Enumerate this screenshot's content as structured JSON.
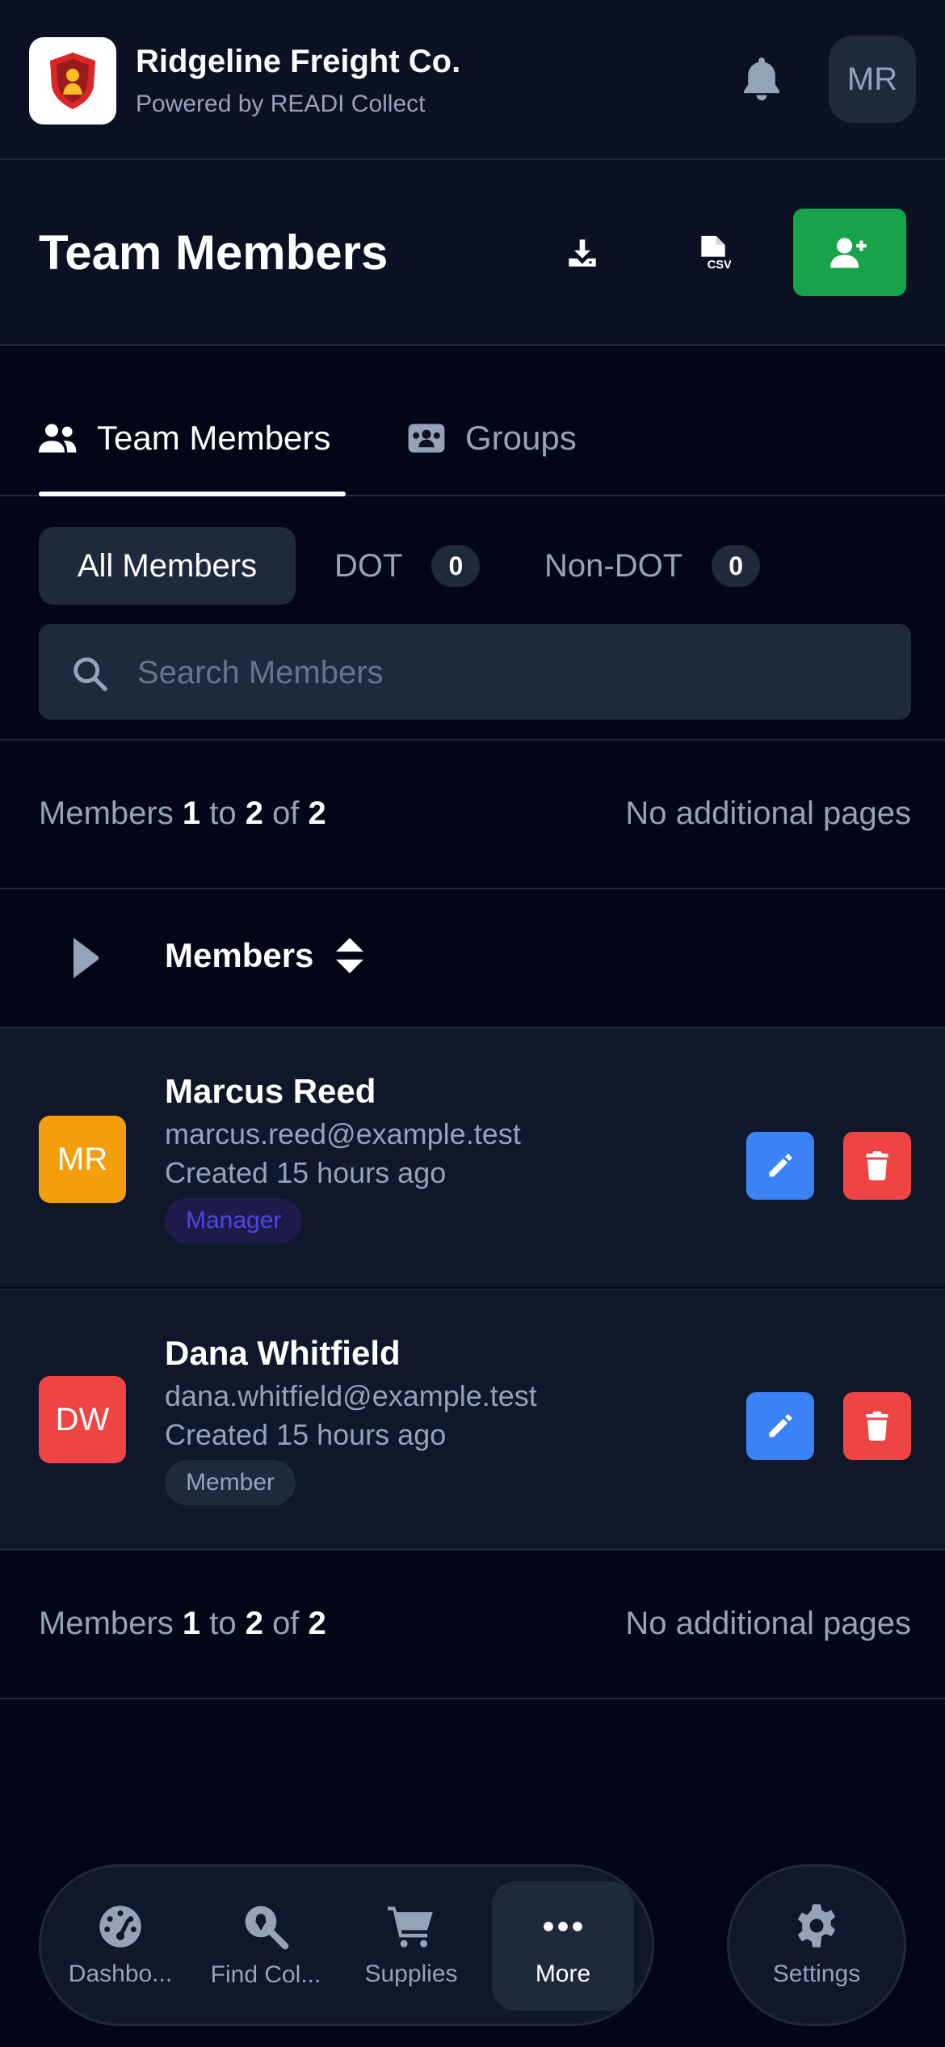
{
  "app": {
    "company_name": "Ridgeline Freight Co.",
    "powered_by": "Powered by READI Collect",
    "user_initials": "MR"
  },
  "page": {
    "title": "Team Members"
  },
  "tabs": [
    {
      "label": "Team Members",
      "active": true,
      "icon": "users-icon"
    },
    {
      "label": "Groups",
      "active": false,
      "icon": "groups-icon"
    }
  ],
  "filters": {
    "all_label": "All Members",
    "dot_label": "DOT",
    "dot_count": "0",
    "nondot_label": "Non-DOT",
    "nondot_count": "0"
  },
  "search": {
    "placeholder": "Search Members"
  },
  "pagination": {
    "prefix": "Members",
    "from": "1",
    "to_word": "to",
    "to": "2",
    "of_word": "of",
    "total": "2",
    "pages_note": "No additional pages"
  },
  "table": {
    "column_label": "Members"
  },
  "members": [
    {
      "initials": "MR",
      "name": "Marcus Reed",
      "email": "marcus.reed@example.test",
      "created": "Created 15 hours ago",
      "role": "Manager",
      "avatar_color": "#f59e0b"
    },
    {
      "initials": "DW",
      "name": "Dana Whitfield",
      "email": "dana.whitfield@example.test",
      "created": "Created 15 hours ago",
      "role": "Member",
      "avatar_color": "#ef4444"
    }
  ],
  "bottom_nav": {
    "items": [
      {
        "label": "Dashbo...",
        "icon": "dashboard-gauge-icon"
      },
      {
        "label": "Find Col...",
        "icon": "find-collector-icon"
      },
      {
        "label": "Supplies",
        "icon": "cart-icon"
      },
      {
        "label": "More",
        "icon": "more-dots-icon",
        "active": true
      }
    ],
    "settings_label": "Settings"
  },
  "colors": {
    "background": "#020617",
    "surface": "#0b1122",
    "row": "#0f172a",
    "add_button": "#16a34a",
    "edit_button": "#3b82f6",
    "delete_button": "#ef4444"
  }
}
